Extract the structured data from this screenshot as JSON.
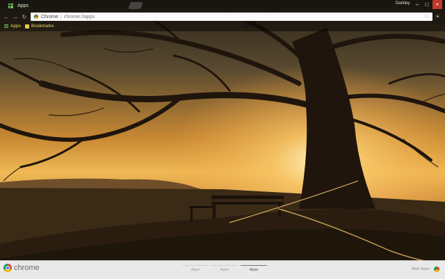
{
  "tab": {
    "title": "Apps",
    "icon": "apps-grid-icon"
  },
  "window": {
    "profile": "Darkley",
    "controls": [
      "minimize",
      "maximize",
      "close"
    ]
  },
  "omnibox": {
    "chip": "Chrome",
    "url": "chrome://apps"
  },
  "bookmarks_bar": {
    "apps_label": "Apps",
    "bookmarks_label": "Bookmarks"
  },
  "footer": {
    "logo": "chrome",
    "pages": [
      {
        "label": "Apps",
        "active": false
      },
      {
        "label": "Apps",
        "active": false
      },
      {
        "label": "Apps",
        "active": true
      }
    ],
    "webstore": "Web Store"
  },
  "colors": {
    "sky": "#e8a93a",
    "footer_bg": "#e9e9e9",
    "apps_green": "#6ec35a",
    "bookmark_text": "#f0e070"
  }
}
